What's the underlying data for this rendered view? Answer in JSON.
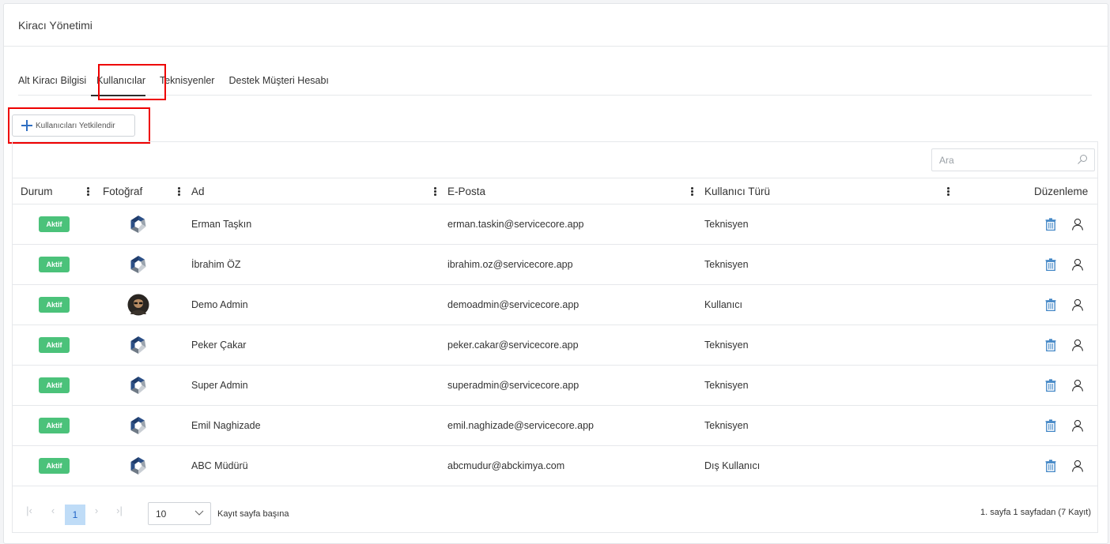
{
  "page": {
    "title": "Kiracı Yönetimi"
  },
  "tabs": [
    {
      "label": "Alt Kiracı Bilgisi",
      "active": false
    },
    {
      "label": "Kullanıcılar",
      "active": true
    },
    {
      "label": "Teknisyenler",
      "active": false
    },
    {
      "label": "Destek Müşteri Hesabı",
      "active": false
    }
  ],
  "toolbar": {
    "add_label": "Kullanıcıları Yetkilendir"
  },
  "search": {
    "placeholder": "Ara",
    "icon": "search-icon"
  },
  "columns": {
    "status": "Durum",
    "photo": "Fotoğraf",
    "name": "Ad",
    "email": "E-Posta",
    "type": "Kullanıcı Türü",
    "edit": "Düzenleme"
  },
  "rows": [
    {
      "status": "Aktif",
      "avatar": "logo",
      "name": "Erman Taşkın",
      "email": "erman.taskin@servicecore.app",
      "type": "Teknisyen"
    },
    {
      "status": "Aktif",
      "avatar": "logo",
      "name": "İbrahim ÖZ",
      "email": "ibrahim.oz@servicecore.app",
      "type": "Teknisyen"
    },
    {
      "status": "Aktif",
      "avatar": "photo",
      "name": "Demo Admin",
      "email": "demoadmin@servicecore.app",
      "type": "Kullanıcı"
    },
    {
      "status": "Aktif",
      "avatar": "logo",
      "name": "Peker Çakar",
      "email": "peker.cakar@servicecore.app",
      "type": "Teknisyen"
    },
    {
      "status": "Aktif",
      "avatar": "logo",
      "name": "Super Admin",
      "email": "superadmin@servicecore.app",
      "type": "Teknisyen"
    },
    {
      "status": "Aktif",
      "avatar": "logo",
      "name": "Emil Naghizade",
      "email": "emil.naghizade@servicecore.app",
      "type": "Teknisyen"
    },
    {
      "status": "Aktif",
      "avatar": "logo",
      "name": "ABC Müdürü",
      "email": "abcmudur@abckimya.com",
      "type": "Dış Kullanıcı"
    }
  ],
  "pager": {
    "current_page": "1",
    "page_size": "10",
    "page_size_label": "Kayıt sayfa başına",
    "info": "1. sayfa 1 sayfadan (7 Kayıt)"
  },
  "colors": {
    "accent": "#2f6fc2",
    "active_badge": "#4bc27a",
    "highlight": "#e00000",
    "pager_current_bg": "#bfdcf7"
  }
}
